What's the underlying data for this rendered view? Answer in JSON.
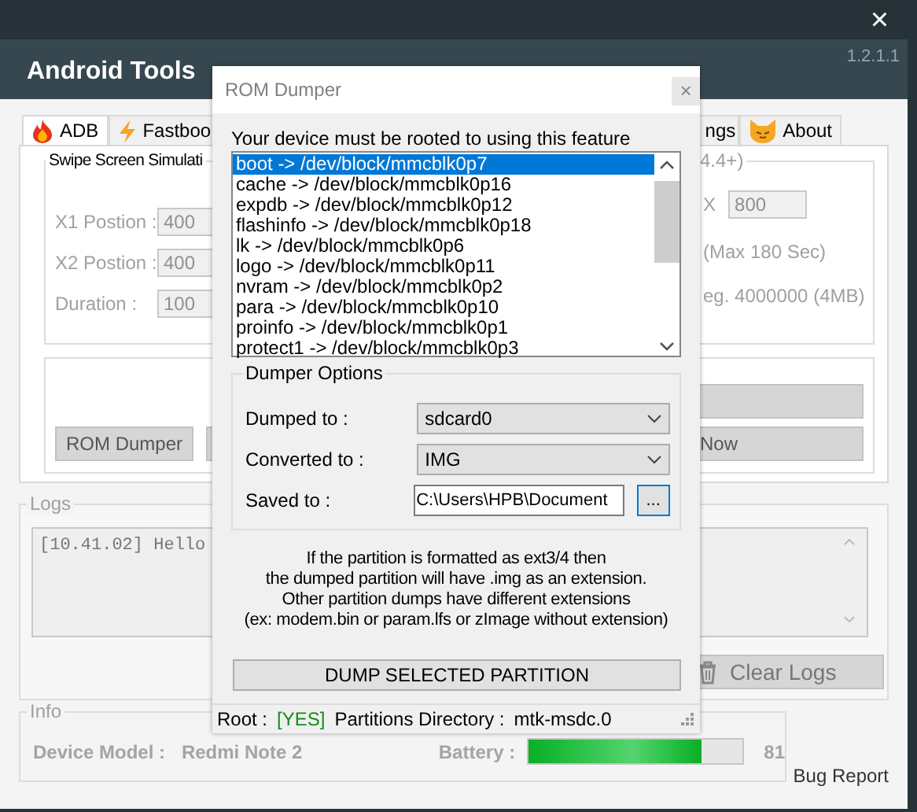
{
  "window": {
    "title": "Android Tools",
    "version": "1.2.1.1",
    "close": "×"
  },
  "tabs": [
    {
      "label": "ADB",
      "selected": true
    },
    {
      "label": "Fastboo",
      "selected": false
    },
    {
      "label": "ngs",
      "selected": false
    },
    {
      "label": "About",
      "selected": false
    }
  ],
  "swipe": {
    "legend": "Swipe Screen Simulati",
    "legend_tail": "4.4+)",
    "disabled": true,
    "fields": [
      {
        "label": "X1 Postion :",
        "value": "400"
      },
      {
        "label": "X2 Postion :",
        "value": "400"
      },
      {
        "label": "Duration :",
        "value": "100"
      }
    ],
    "x_label": "X",
    "x_value": "800",
    "notes": [
      "(Max 180 Sec)",
      "eg. 4000000 (4MB)"
    ]
  },
  "actions": {
    "rom_dumper": "ROM Dumper",
    "now": "Now"
  },
  "logs": {
    "legend": "Logs",
    "lines": [
      "[10.41.02] Hello"
    ],
    "clear_button": "Clear Logs"
  },
  "info": {
    "legend": "Info",
    "device_model_label": "Device Model :",
    "device_model": "Redmi Note 2",
    "battery_label": "Battery :",
    "battery": {
      "level": 0.81,
      "reading": "81"
    }
  },
  "bug_report": "Bug Report",
  "dialog": {
    "title": "ROM Dumper",
    "close": "×",
    "note": "Your device must be rooted to using this feature",
    "partitions": [
      {
        "label": "boot -> /dev/block/mmcblk0p7",
        "selected": true
      },
      {
        "label": "cache -> /dev/block/mmcblk0p16",
        "selected": false
      },
      {
        "label": "expdb -> /dev/block/mmcblk0p12",
        "selected": false
      },
      {
        "label": "flashinfo -> /dev/block/mmcblk0p18",
        "selected": false
      },
      {
        "label": "lk -> /dev/block/mmcblk0p6",
        "selected": false
      },
      {
        "label": "logo -> /dev/block/mmcblk0p11",
        "selected": false
      },
      {
        "label": "nvram -> /dev/block/mmcblk0p2",
        "selected": false
      },
      {
        "label": "para -> /dev/block/mmcblk0p10",
        "selected": false
      },
      {
        "label": "proinfo -> /dev/block/mmcblk0p1",
        "selected": false
      },
      {
        "label": "protect1 -> /dev/block/mmcblk0p3",
        "selected": false
      }
    ],
    "options": {
      "legend": "Dumper Options",
      "rows": [
        {
          "kind": "select",
          "label": "Dumped to :",
          "value": "sdcard0"
        },
        {
          "kind": "select",
          "label": "Converted to :",
          "value": "IMG"
        },
        {
          "kind": "path",
          "label": "Saved to :",
          "value": "C:\\Users\\HPB\\Document",
          "browse": "..."
        }
      ]
    },
    "explanation": [
      "If the partition is formatted as ext3/4 then",
      "the dumped partition will have .img as an extension.",
      "Other partition dumps have different extensions",
      "(ex: modem.bin or param.lfs or zImage without extension)"
    ],
    "dump_button": "DUMP SELECTED PARTITION",
    "status": {
      "root_label": "Root :",
      "root_value": "[YES]",
      "dir_label": "Partitions Directory :",
      "dir_value": "mtk-msdc.0"
    }
  }
}
